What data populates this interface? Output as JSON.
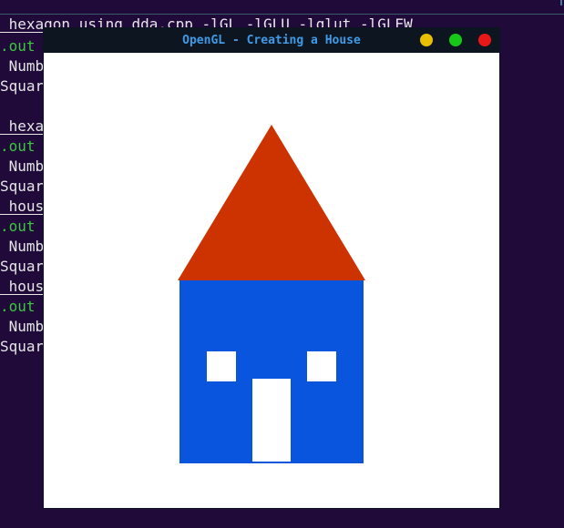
{
  "terminal": {
    "lines": [
      {
        "text": " hexagon_using_dda.cpp -lGL -lGLU -lglut -lGLEW",
        "style": "cmd"
      },
      {
        "text": ".out",
        "style": "green"
      },
      {
        "text": " Numb",
        "style": "plain"
      },
      {
        "text": "Squar",
        "style": "plain"
      },
      {
        "text": " hexa",
        "style": "cmd"
      },
      {
        "text": ".out",
        "style": "green"
      },
      {
        "text": " Numb",
        "style": "plain"
      },
      {
        "text": "Squar",
        "style": "plain"
      },
      {
        "text": " hous",
        "style": "cmd"
      },
      {
        "text": ".out",
        "style": "green"
      },
      {
        "text": " Numb",
        "style": "plain"
      },
      {
        "text": "Squar",
        "style": "plain"
      },
      {
        "text": " hous",
        "style": "cmd"
      },
      {
        "text": ".out",
        "style": "green"
      },
      {
        "text": " Numb",
        "style": "plain"
      },
      {
        "text": "Squar",
        "style": "plain"
      }
    ]
  },
  "window": {
    "title": "OpenGL - Creating a House",
    "buttons": {
      "minimize_color": "#e8c000",
      "maximize_color": "#18c818",
      "close_color": "#e81818"
    }
  },
  "scene": {
    "background_color": "#ffffff",
    "roof_color": "#cc3300",
    "wall_color": "#0a55dd",
    "window_color": "#ffffff",
    "door_color": "#ffffff"
  }
}
